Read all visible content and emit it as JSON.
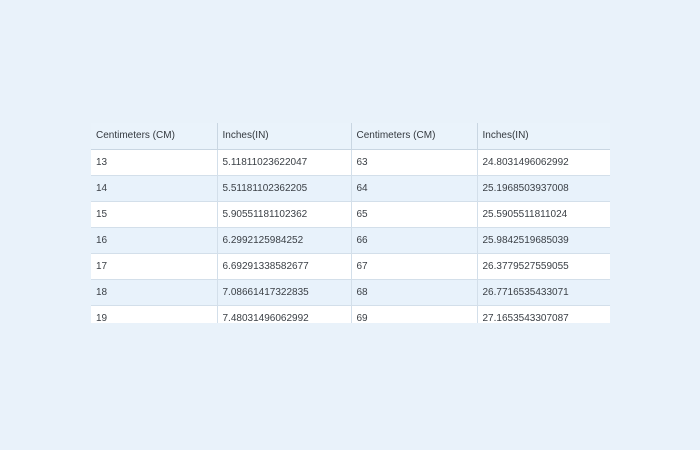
{
  "table": {
    "headers": [
      "Centimeters (CM)",
      "Inches(IN)",
      "Centimeters (CM)",
      "Inches(IN)"
    ],
    "rows": [
      [
        "13",
        "5.11811023622047",
        "63",
        "24.8031496062992"
      ],
      [
        "14",
        "5.51181102362205",
        "64",
        "25.1968503937008"
      ],
      [
        "15",
        "5.90551181102362",
        "65",
        "25.5905511811024"
      ],
      [
        "16",
        "6.2992125984252",
        "66",
        "25.9842519685039"
      ],
      [
        "17",
        "6.69291338582677",
        "67",
        "26.3779527559055"
      ],
      [
        "18",
        "7.08661417322835",
        "68",
        "26.7716535433071"
      ],
      [
        "19",
        "7.48031496062992",
        "69",
        "27.1653543307087"
      ]
    ]
  }
}
